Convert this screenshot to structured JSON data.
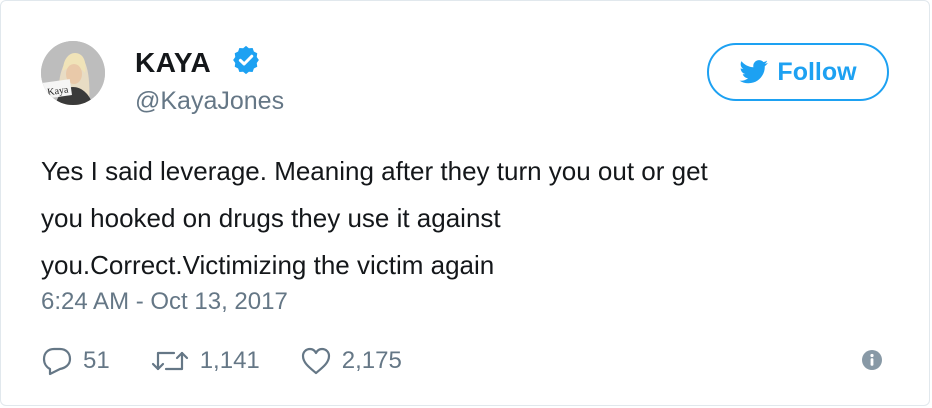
{
  "user": {
    "display_name": "KAYA",
    "handle": "@KayaJones",
    "avatar_caption": "Kaya",
    "verified": true
  },
  "follow_button": {
    "label": "Follow"
  },
  "tweet": {
    "lines": [
      "Yes I said leverage. Meaning after they turn you out or get",
      "you hooked on drugs they use it against",
      "you.Correct.Victimizing the victim again"
    ],
    "timestamp": "6:24 AM - Oct 13, 2017"
  },
  "actions": {
    "replies": "51",
    "retweets": "1,141",
    "likes": "2,175"
  },
  "colors": {
    "accent": "#1da1f2",
    "muted": "#657786",
    "text": "#14171a"
  },
  "icons": [
    "verified-badge-icon",
    "bird-icon",
    "reply-icon",
    "retweet-icon",
    "heart-icon",
    "info-icon"
  ]
}
